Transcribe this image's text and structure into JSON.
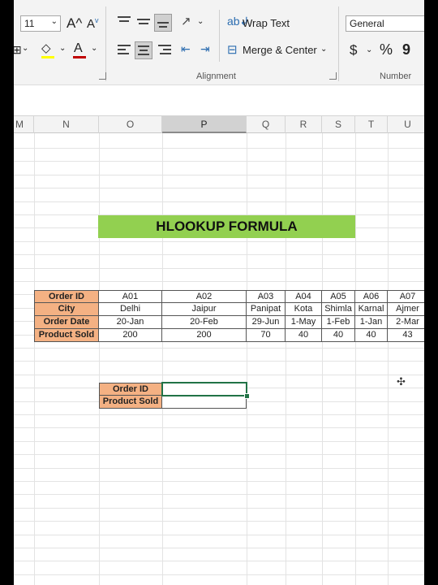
{
  "ribbon": {
    "font_size": "11",
    "grow_font": "A^",
    "shrink_font": "A",
    "font_color_glyph": "A",
    "wrap_text_label": "Wrap Text",
    "merge_center_label": "Merge & Center",
    "number_format": "General",
    "currency": "$",
    "percent": "%",
    "comma": "9",
    "alignment_group_label": "Alignment",
    "number_group_label": "Number",
    "accent_fill_color": "#ffff00",
    "accent_font_color": "#c00000"
  },
  "columns": [
    {
      "label": "M"
    },
    {
      "label": "N"
    },
    {
      "label": "O"
    },
    {
      "label": "P"
    },
    {
      "label": "Q"
    },
    {
      "label": "R"
    },
    {
      "label": "S"
    },
    {
      "label": "T"
    },
    {
      "label": "U"
    }
  ],
  "selected_column": "P",
  "sheet": {
    "title": "HLOOKUP FORMULA",
    "title_color": "#92d050",
    "header_color": "#f4b183",
    "table": {
      "row_headers": [
        "Order ID",
        "City",
        "Order Date",
        "Product Sold"
      ],
      "rows": [
        [
          "A01",
          "A02",
          "A03",
          "A04",
          "A05",
          "A06",
          "A07"
        ],
        [
          "Delhi",
          "Jaipur",
          "Panipat",
          "Kota",
          "Shimla",
          "Karnal",
          "Ajmer"
        ],
        [
          "20-Jan",
          "20-Feb",
          "29-Jun",
          "1-May",
          "1-Feb",
          "1-Jan",
          "2-Mar"
        ],
        [
          "200",
          "200",
          "70",
          "40",
          "40",
          "40",
          "43"
        ]
      ]
    },
    "lookup": {
      "labels": [
        "Order ID",
        "Product Sold"
      ],
      "values": [
        "",
        ""
      ]
    }
  }
}
